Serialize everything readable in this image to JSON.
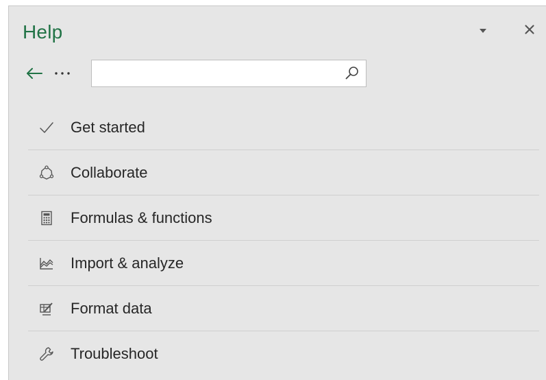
{
  "pane": {
    "title": "Help",
    "accent_color": "#217346",
    "dropdown_icon": "chevron-down-icon",
    "close_label": "✕",
    "back_label": "←",
    "more_label": "···",
    "search": {
      "value": "",
      "placeholder": "",
      "icon": "search-icon"
    }
  },
  "items": [
    {
      "label": "Get started",
      "icon": "checkmark-icon"
    },
    {
      "label": "Collaborate",
      "icon": "collaborate-icon"
    },
    {
      "label": "Formulas & functions",
      "icon": "calculator-icon"
    },
    {
      "label": "Import & analyze",
      "icon": "chart-icon"
    },
    {
      "label": "Format data",
      "icon": "format-icon"
    },
    {
      "label": "Troubleshoot",
      "icon": "wrench-icon"
    }
  ]
}
